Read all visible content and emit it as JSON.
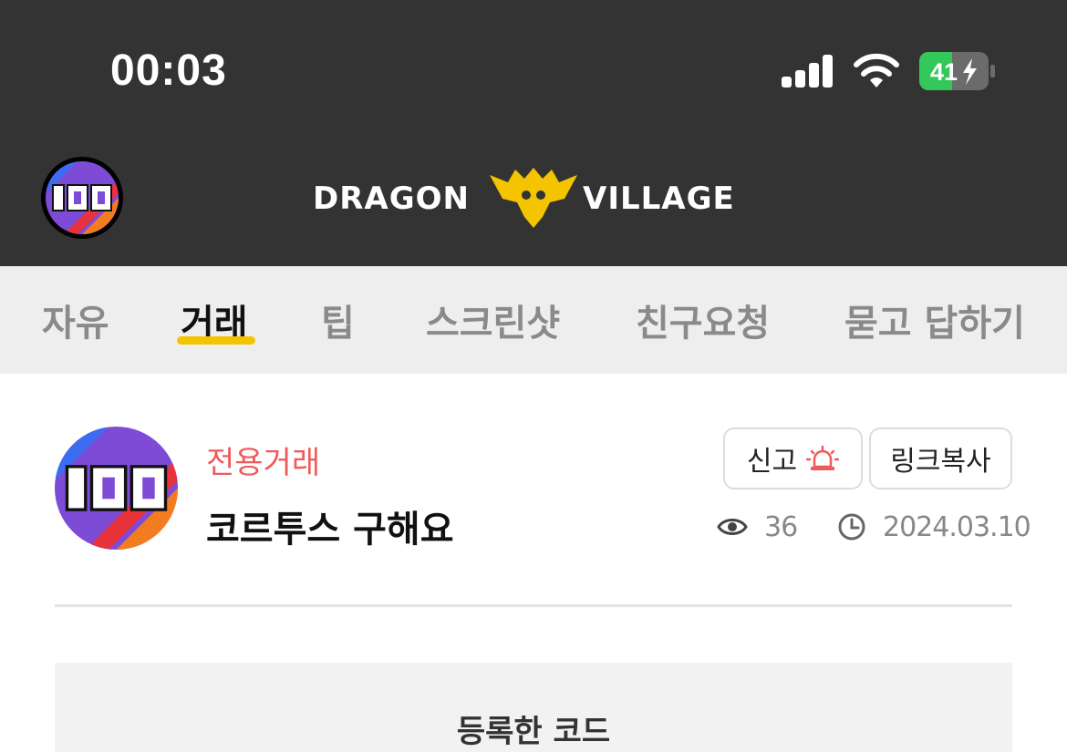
{
  "status_bar": {
    "time": "00:03",
    "battery": "41",
    "battery_color": "#34c759"
  },
  "header": {
    "logo_left": "DRAGON",
    "logo_right": "VILLAGE",
    "accent": "#f5c400"
  },
  "tabs": [
    {
      "label": "자유",
      "active": false
    },
    {
      "label": "거래",
      "active": true
    },
    {
      "label": "팁",
      "active": false
    },
    {
      "label": "스크린샷",
      "active": false
    },
    {
      "label": "친구요청",
      "active": false
    },
    {
      "label": "묻고 답하기",
      "active": false
    }
  ],
  "post": {
    "category": "전용거래",
    "title": "코르투스 구해요",
    "report_label": "신고",
    "copy_link_label": "링크복사",
    "views": "36",
    "date": "2024.03.10",
    "category_color": "#ef5b5b"
  },
  "code_section": {
    "title": "등록한 코드"
  }
}
